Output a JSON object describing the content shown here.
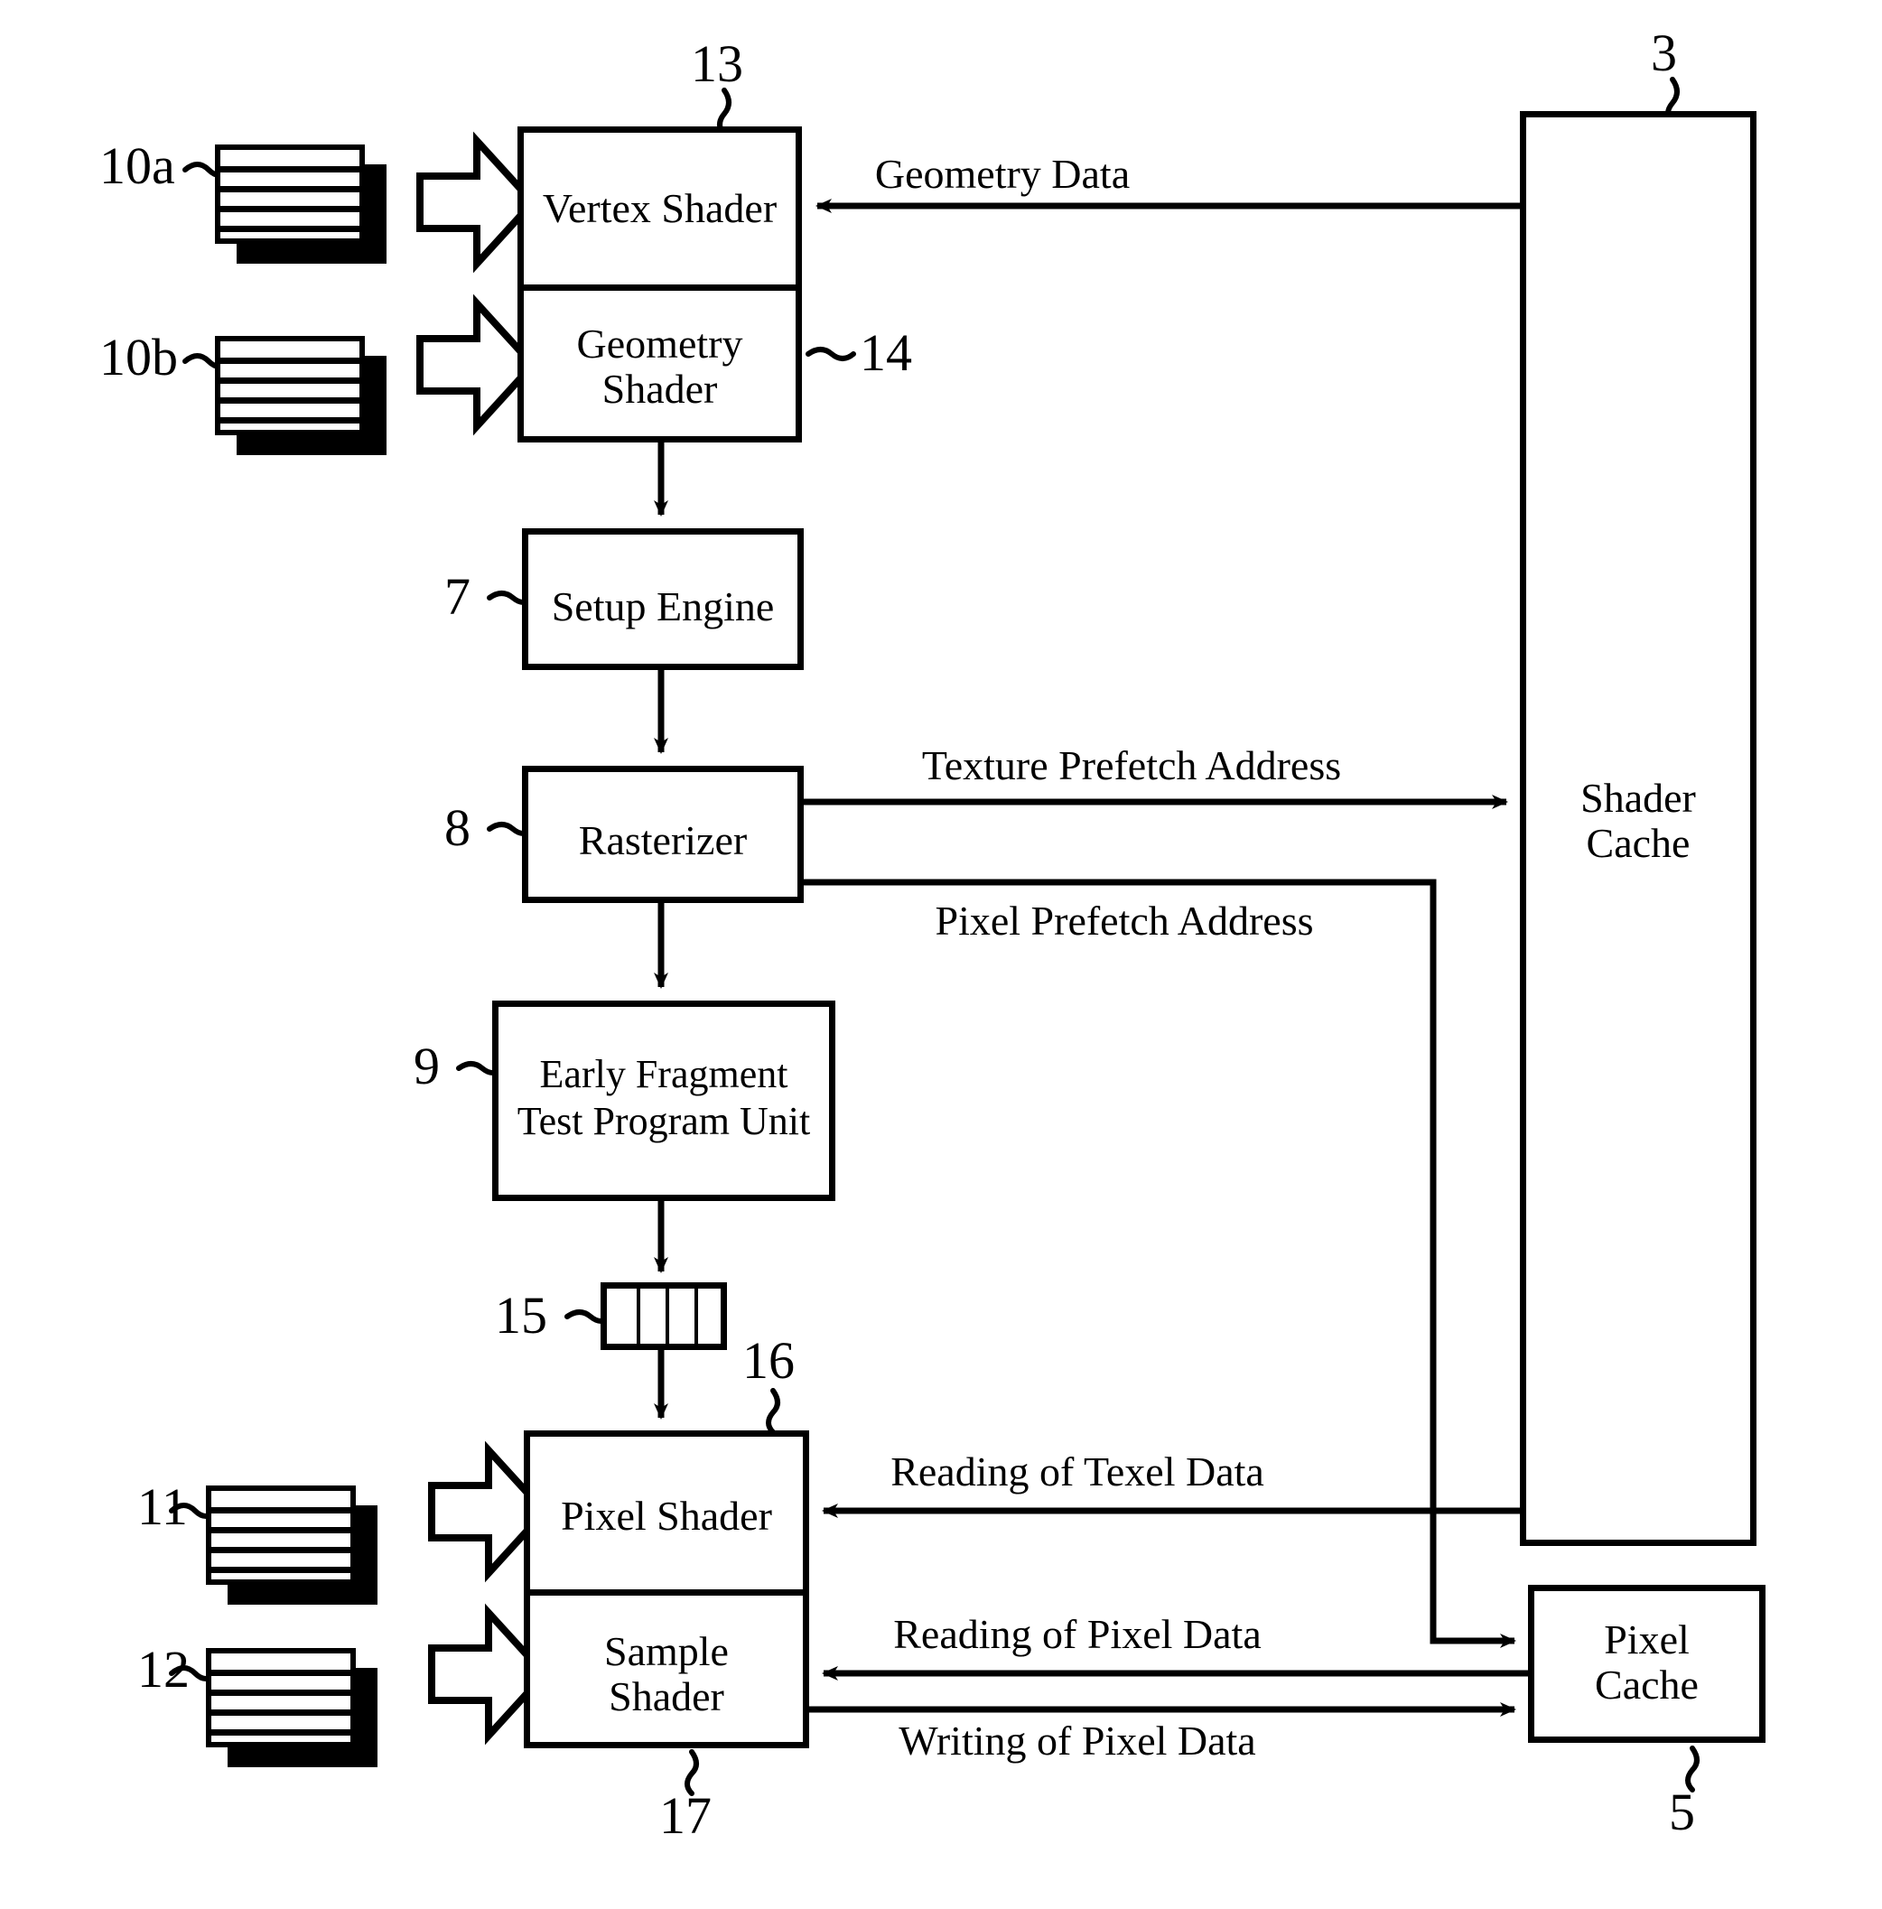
{
  "figure": {
    "type": "patent-block-diagram",
    "blocks": [
      {
        "id": "vertex_shader",
        "label": "Vertex Shader",
        "numeral": "13"
      },
      {
        "id": "geometry_shader",
        "label": "Geometry\nShader",
        "numeral": "14"
      },
      {
        "id": "setup_engine",
        "label": "Setup Engine",
        "numeral": "7"
      },
      {
        "id": "rasterizer",
        "label": "Rasterizer",
        "numeral": "8"
      },
      {
        "id": "early_fragment",
        "label": "Early Fragment\nTest Program Unit",
        "numeral": "9"
      },
      {
        "id": "fifo",
        "label": "",
        "numeral": "15"
      },
      {
        "id": "pixel_shader",
        "label": "Pixel Shader",
        "numeral": "16"
      },
      {
        "id": "sample_shader",
        "label": "Sample\nShader",
        "numeral": "17"
      },
      {
        "id": "shader_cache",
        "label": "Shader\nCache",
        "numeral": "3"
      },
      {
        "id": "pixel_cache",
        "label": "Pixel\nCache",
        "numeral": "5"
      }
    ],
    "inputs": [
      {
        "id": "input_10a",
        "numeral": "10a"
      },
      {
        "id": "input_10b",
        "numeral": "10b"
      },
      {
        "id": "input_11",
        "numeral": "11"
      },
      {
        "id": "input_12",
        "numeral": "12"
      }
    ],
    "connections": [
      {
        "id": "geometry_data",
        "label": "Geometry Data",
        "from": "shader_cache",
        "to": "vertex_shader"
      },
      {
        "id": "texture_prefetch_address",
        "label": "Texture Prefetch Address",
        "from": "rasterizer",
        "to": "shader_cache"
      },
      {
        "id": "pixel_prefetch_address",
        "label": "Pixel Prefetch Address",
        "from": "rasterizer",
        "to": "pixel_cache"
      },
      {
        "id": "reading_of_texel_data",
        "label": "Reading of Texel Data",
        "from": "shader_cache",
        "to": "pixel_shader"
      },
      {
        "id": "reading_of_pixel_data",
        "label": "Reading of Pixel Data",
        "from": "pixel_cache",
        "to": "sample_shader"
      },
      {
        "id": "writing_of_pixel_data",
        "label": "Writing of Pixel Data",
        "from": "sample_shader",
        "to": "pixel_cache"
      }
    ],
    "numerals": {
      "n3": "3",
      "n5": "5",
      "n7": "7",
      "n8": "8",
      "n9": "9",
      "n10a": "10a",
      "n10b": "10b",
      "n11": "11",
      "n12": "12",
      "n13": "13",
      "n14": "14",
      "n15": "15",
      "n16": "16",
      "n17": "17"
    },
    "labels": {
      "vertex_shader": "Vertex Shader",
      "geometry_shader_line1": "Geometry",
      "geometry_shader_line2": "Shader",
      "setup_engine": "Setup Engine",
      "rasterizer": "Rasterizer",
      "early_fragment_line1": "Early Fragment",
      "early_fragment_line2": "Test Program Unit",
      "pixel_shader": "Pixel Shader",
      "sample_shader_line1": "Sample",
      "sample_shader_line2": "Shader",
      "shader_cache_line1": "Shader",
      "shader_cache_line2": "Cache",
      "pixel_cache_line1": "Pixel",
      "pixel_cache_line2": "Cache",
      "geometry_data": "Geometry Data",
      "texture_prefetch_address": "Texture Prefetch Address",
      "pixel_prefetch_address": "Pixel Prefetch Address",
      "reading_of_texel_data": "Reading of Texel Data",
      "reading_of_pixel_data": "Reading of Pixel Data",
      "writing_of_pixel_data": "Writing of Pixel Data"
    },
    "colors": {
      "ink": "#000000",
      "paper": "#ffffff"
    }
  }
}
